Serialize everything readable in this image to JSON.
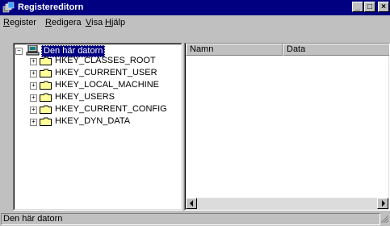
{
  "window": {
    "title": "Registereditorn"
  },
  "title_buttons": {
    "minimize": "_",
    "maximize": "□",
    "close": "×"
  },
  "menu": [
    {
      "accel": "R",
      "rest": "egister"
    },
    {
      "accel": "R",
      "rest": "edigera"
    },
    {
      "accel": "V",
      "rest": "isa"
    },
    {
      "accel": "H",
      "rest": "jälp"
    }
  ],
  "tree": {
    "root": {
      "label": "Den här datorn",
      "expander": "−"
    },
    "keys": [
      {
        "label": "HKEY_CLASSES_ROOT",
        "expander": "+"
      },
      {
        "label": "HKEY_CURRENT_USER",
        "expander": "+"
      },
      {
        "label": "HKEY_LOCAL_MACHINE",
        "expander": "+"
      },
      {
        "label": "HKEY_USERS",
        "expander": "+"
      },
      {
        "label": "HKEY_CURRENT_CONFIG",
        "expander": "+"
      },
      {
        "label": "HKEY_DYN_DATA",
        "expander": "+"
      }
    ]
  },
  "list": {
    "columns": [
      "Namn",
      "Data"
    ]
  },
  "statusbar": {
    "text": "Den här datorn"
  },
  "colors": {
    "title_bg": "#000080",
    "face": "#c0c0c0",
    "folder": "#ffff99",
    "selection": "#000080"
  }
}
